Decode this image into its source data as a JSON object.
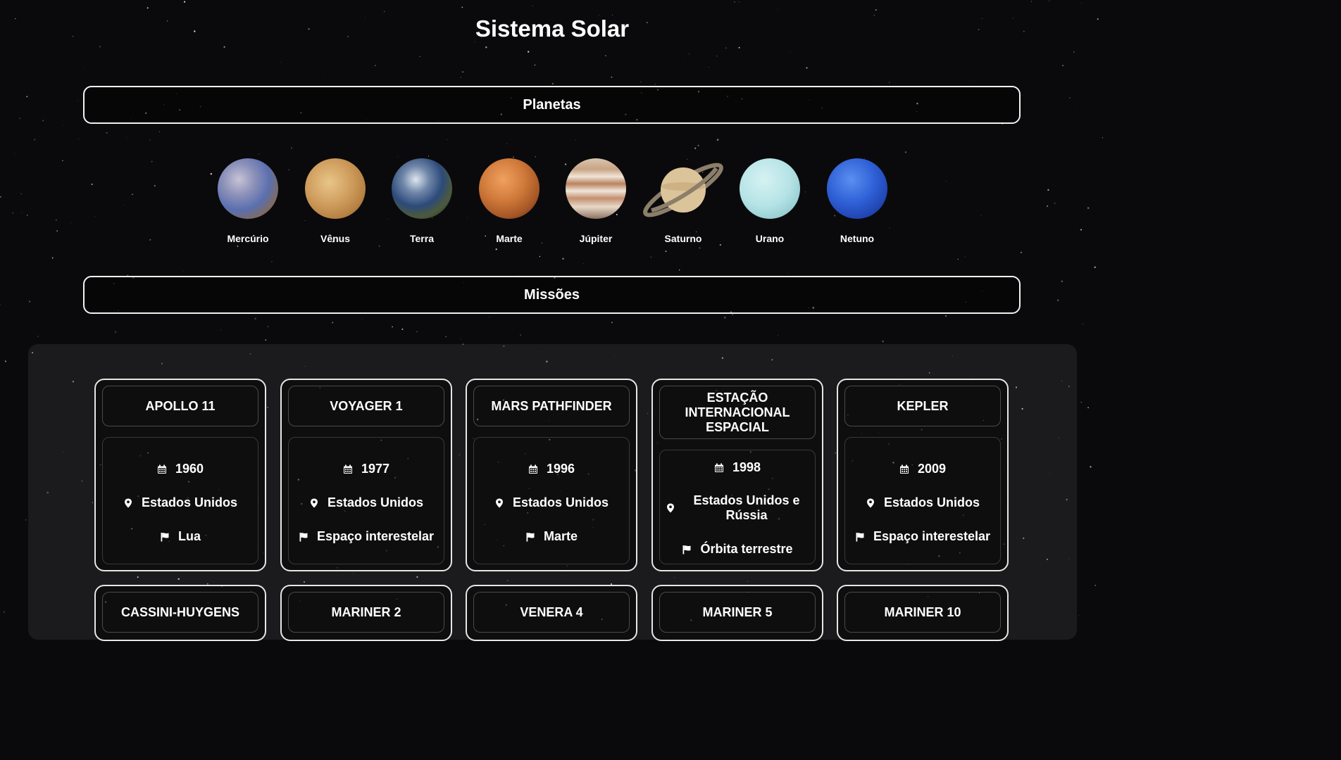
{
  "page": {
    "title": "Sistema Solar"
  },
  "sections": {
    "planets": "Planetas",
    "missions": "Missões"
  },
  "planets": [
    {
      "name": "Mercúrio"
    },
    {
      "name": "Vênus"
    },
    {
      "name": "Terra"
    },
    {
      "name": "Marte"
    },
    {
      "name": "Júpiter"
    },
    {
      "name": "Saturno"
    },
    {
      "name": "Urano"
    },
    {
      "name": "Netuno"
    }
  ],
  "missions": [
    {
      "name": "Apollo 11",
      "year": "1960",
      "country": "Estados Unidos",
      "destination": "Lua"
    },
    {
      "name": "Voyager 1",
      "year": "1977",
      "country": "Estados Unidos",
      "destination": "Espaço interestelar"
    },
    {
      "name": "Mars Pathfinder",
      "year": "1996",
      "country": "Estados Unidos",
      "destination": "Marte"
    },
    {
      "name": "Estação Internacional Espacial",
      "year": "1998",
      "country": "Estados Unidos e Rússia",
      "destination": "Órbita terrestre"
    },
    {
      "name": "Kepler",
      "year": "2009",
      "country": "Estados Unidos",
      "destination": "Espaço interestelar"
    },
    {
      "name": "Cassini-Huygens"
    },
    {
      "name": "Mariner 2"
    },
    {
      "name": "Venera 4"
    },
    {
      "name": "Mariner 5"
    },
    {
      "name": "Mariner 10"
    }
  ],
  "icons": {
    "year": "calendar-icon",
    "country": "map-pin-icon",
    "destination": "flag-icon"
  }
}
